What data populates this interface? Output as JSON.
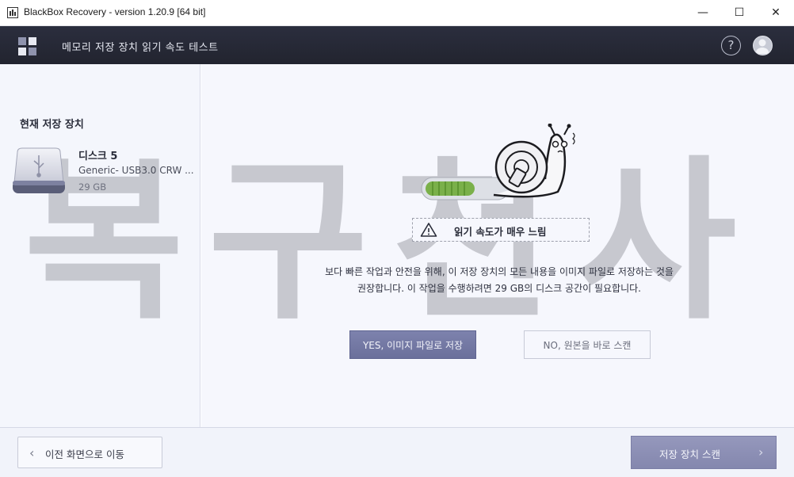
{
  "window": {
    "title": "BlackBox Recovery - version 1.20.9 [64 bit]",
    "minimize_glyph": "—",
    "maximize_glyph": "☐",
    "close_glyph": "✕"
  },
  "header": {
    "title": "메모리 저장 장치 읽기 속도 테스트",
    "help_glyph": "?"
  },
  "left_panel": {
    "section_title": "현재 저장 장치",
    "device": {
      "name": "디스크 5",
      "model": "Generic- USB3.0 CRW  ...",
      "size": "29 GB"
    }
  },
  "watermark": {
    "text": "복구천사"
  },
  "main": {
    "warning": "읽기 속도가 매우 느림",
    "description_line1": "보다 빠른 작업과 안전을 위해, 이 저장 장치의 모든 내용을 이미지 파일로 저장하는 것을",
    "description_line2": "권장합니다. 이 작업을 수행하려면 29 GB의 디스크 공간이 필요합니다.",
    "yes_button": "YES, 이미지 파일로 저장",
    "no_button": "NO, 원본을 바로 스캔"
  },
  "footer": {
    "back_button": "이전 화면으로 이동",
    "scan_button": "저장 장치 스캔",
    "back_chevron": "‹",
    "next_chevron": "›"
  },
  "colors": {
    "header_bg": "#2b2e3e",
    "primary_button": "#7d82ad",
    "scan_button": "#9598bc",
    "progress_green": "#6fa33e"
  }
}
